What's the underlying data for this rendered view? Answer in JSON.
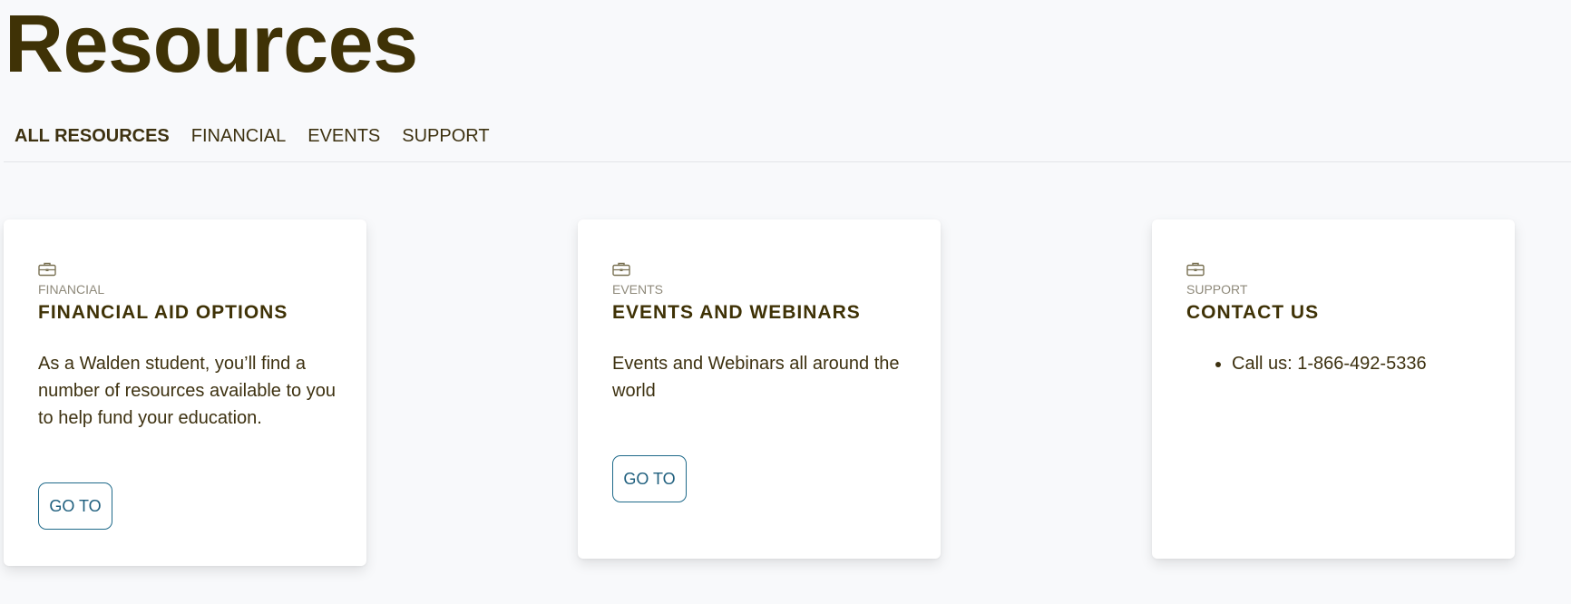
{
  "page": {
    "title": "Resources"
  },
  "tabs": [
    {
      "label": "ALL RESOURCES",
      "active": true
    },
    {
      "label": "FINANCIAL",
      "active": false
    },
    {
      "label": "EVENTS",
      "active": false
    },
    {
      "label": "SUPPORT",
      "active": false
    }
  ],
  "cards": [
    {
      "icon": "briefcase-icon",
      "category": "FINANCIAL",
      "title": "FINANCIAL AID OPTIONS",
      "description": "As a Walden student, you’ll find a number of resources available to you to help fund your education.",
      "button_label": "GO TO"
    },
    {
      "icon": "briefcase-icon",
      "category": "EVENTS",
      "title": "EVENTS AND WEBINARS",
      "description": "Events and Webinars all around the world",
      "button_label": "GO TO"
    },
    {
      "icon": "briefcase-icon",
      "category": "SUPPORT",
      "title": "CONTACT US",
      "list_items": [
        "Call us: 1-866-492-5336"
      ]
    }
  ],
  "colors": {
    "heading": "#3f3206",
    "text": "#3d3110",
    "category": "#8f8a7b",
    "button_border": "#1f6a8a",
    "background": "#f8f9fb",
    "card": "#ffffff"
  }
}
